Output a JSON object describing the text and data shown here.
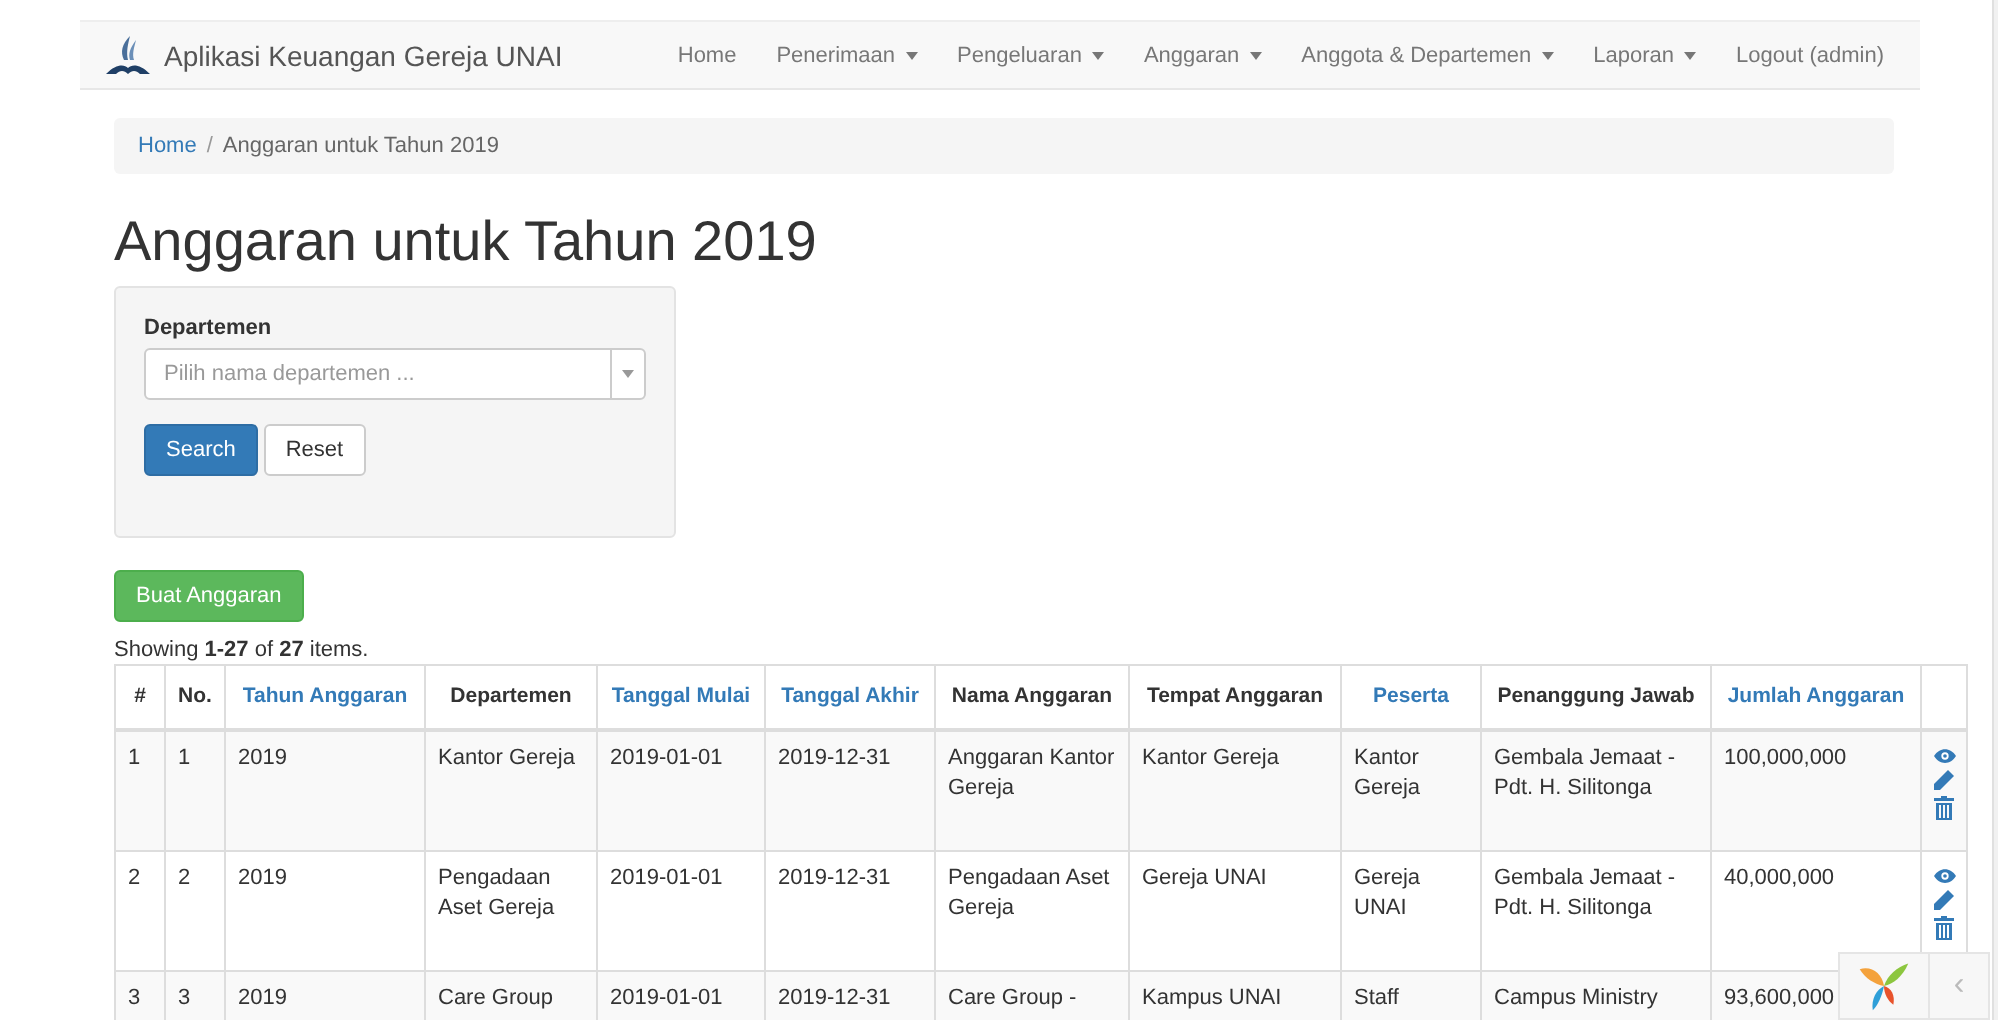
{
  "navbar": {
    "brand": "Aplikasi Keuangan Gereja UNAI",
    "items": [
      {
        "label": "Home",
        "dropdown": false
      },
      {
        "label": "Penerimaan",
        "dropdown": true
      },
      {
        "label": "Pengeluaran",
        "dropdown": true
      },
      {
        "label": "Anggaran",
        "dropdown": true
      },
      {
        "label": "Anggota & Departemen",
        "dropdown": true
      },
      {
        "label": "Laporan",
        "dropdown": true
      },
      {
        "label": "Logout (admin)",
        "dropdown": false
      }
    ]
  },
  "breadcrumb": {
    "separator": "/",
    "items": [
      {
        "label": "Home",
        "link": true
      },
      {
        "label": "Anggaran untuk Tahun 2019",
        "link": false
      }
    ]
  },
  "title": "Anggaran untuk Tahun 2019",
  "filter": {
    "label": "Departemen",
    "placeholder": "Pilih nama departemen ...",
    "buttons": [
      {
        "label": "Search",
        "kind": "primary"
      },
      {
        "label": "Reset",
        "kind": "default"
      }
    ]
  },
  "create_button": "Buat Anggaran",
  "summary": "Showing **1-27** of **27** items.",
  "table": {
    "columns": [
      {
        "label": "#",
        "sortable": false
      },
      {
        "label": "No.",
        "sortable": false
      },
      {
        "label": "Tahun Anggaran",
        "sortable": true
      },
      {
        "label": "Departemen",
        "sortable": false
      },
      {
        "label": "Tanggal Mulai",
        "sortable": true
      },
      {
        "label": "Tanggal Akhir",
        "sortable": true
      },
      {
        "label": "Nama Anggaran",
        "sortable": false
      },
      {
        "label": "Tempat Anggaran",
        "sortable": false
      },
      {
        "label": "Peserta",
        "sortable": true
      },
      {
        "label": "Penanggung Jawab",
        "sortable": false
      },
      {
        "label": "Jumlah Anggaran",
        "sortable": true
      }
    ],
    "rows": [
      {
        "cells": [
          "1",
          "1",
          "2019",
          "Kantor Gereja",
          "2019-01-01",
          "2019-12-31",
          "Anggaran Kantor Gereja",
          "Kantor Gereja",
          "Kantor Gereja",
          "Gembala Jemaat - Pdt. H. Silitonga",
          "100,000,000"
        ],
        "actions": true
      },
      {
        "cells": [
          "2",
          "2",
          "2019",
          "Pengadaan Aset Gereja",
          "2019-01-01",
          "2019-12-31",
          "Pengadaan Aset Gereja",
          "Gereja UNAI",
          "Gereja UNAI",
          "Gembala Jemaat - Pdt. H. Silitonga",
          "40,000,000"
        ],
        "actions": true
      },
      {
        "cells": [
          "3",
          "3",
          "2019",
          "Care Group",
          "2019-01-01",
          "2019-12-31",
          "Care Group -",
          "Kampus UNAI",
          "Staff",
          "Campus Ministry",
          "93,600,000"
        ]
      }
    ]
  },
  "debug_toolbar": {
    "toggle": "‹"
  }
}
